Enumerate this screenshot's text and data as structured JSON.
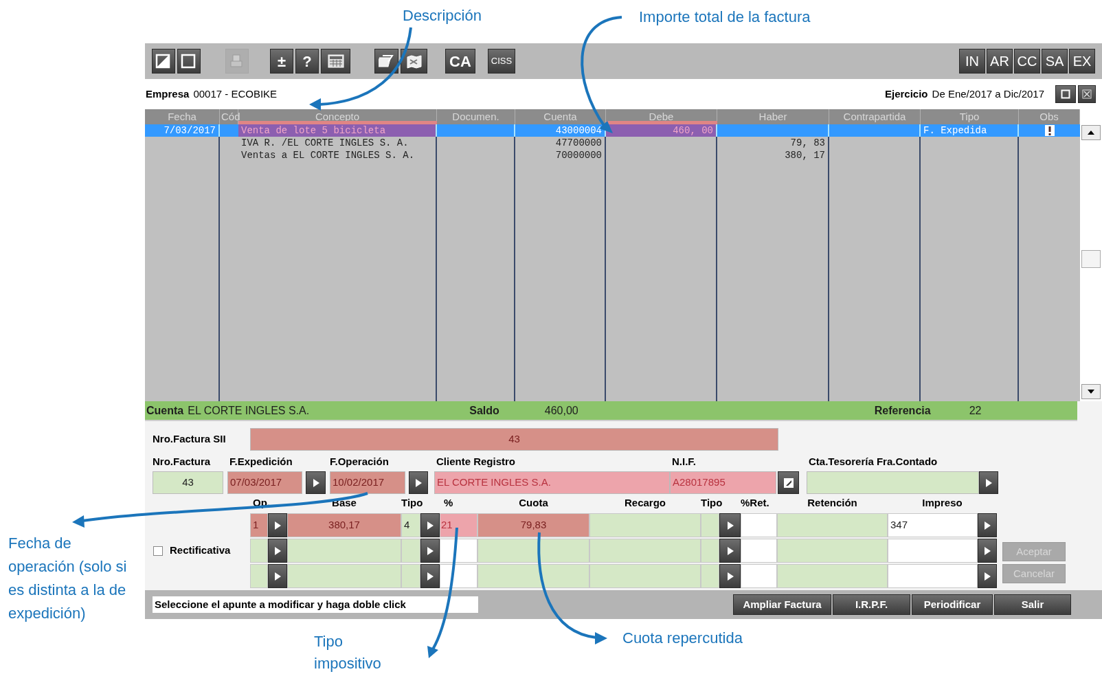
{
  "annotations": [
    {
      "text": "Descripción"
    },
    {
      "text": "Importe total de la factura"
    },
    {
      "text": "Fecha de operación (solo si es distinta a la de expedición)"
    },
    {
      "text": "Tipo impositivo"
    },
    {
      "text": "Cuota repercutida"
    }
  ],
  "toolbar": {
    "left": [
      {
        "kind": "icon",
        "disabled": false
      },
      {
        "kind": "icon",
        "disabled": false
      },
      {
        "kind": "icon",
        "disabled": true
      },
      {
        "kind": "text",
        "label": "±",
        "disabled": false
      },
      {
        "kind": "text",
        "label": "?",
        "disabled": false
      },
      {
        "kind": "icon",
        "disabled": false
      },
      {
        "kind": "icon",
        "disabled": false
      },
      {
        "kind": "icon",
        "disabled": false
      },
      {
        "kind": "text",
        "label": "CA",
        "disabled": false
      },
      {
        "kind": "text",
        "label": "CISS",
        "disabled": false
      }
    ],
    "right": [
      "IN",
      "AR",
      "CC",
      "SA",
      "EX"
    ]
  },
  "company": {
    "label": "Empresa",
    "value": "00017 - ECOBIKE"
  },
  "period": {
    "label": "Ejercicio",
    "value": "De Ene/2017 a Dic/2017"
  },
  "table": {
    "columns": [
      "Fecha",
      "Cód",
      "Concepto",
      "Documen.",
      "Cuenta",
      "Debe",
      "Haber",
      "Contrapartida",
      "Tipo",
      "Obs"
    ],
    "rows": [
      {
        "selected": true,
        "flag": true,
        "marked": true,
        "cells": [
          "7/03/2017",
          "",
          "Venta de lote 5 bicicleta",
          "",
          "43000004",
          "460, 00",
          "",
          "",
          "F. Expedida"
        ]
      },
      {
        "selected": false,
        "flag": false,
        "marked": false,
        "cells": [
          "",
          "",
          "IVA R. /EL CORTE INGLES S. A.",
          "",
          "47700000",
          "",
          "79, 83",
          "",
          ""
        ]
      },
      {
        "selected": false,
        "flag": false,
        "marked": false,
        "cells": [
          "",
          "",
          "Ventas a EL CORTE INGLES S. A.",
          "",
          "70000000",
          "",
          "380, 17",
          "",
          ""
        ]
      }
    ]
  },
  "account_bar": {
    "cuenta_label": "Cuenta",
    "cuenta": "EL CORTE INGLES S.A.",
    "saldo_label": "Saldo",
    "saldo": "460,00",
    "referencia_label": "Referencia",
    "referencia": "22"
  },
  "invoice_sii": {
    "label": "Nro.Factura SII",
    "value": "43",
    "color": "#d69088"
  },
  "header_fields": [
    {
      "label": "Nro.Factura",
      "value": "43",
      "color": "#d5e8c6"
    },
    {
      "label": "F.Expedición",
      "value": "07/03/2017",
      "color": "#d69088"
    },
    {
      "label": "F.Operación",
      "value": "10/02/2017",
      "color": "#d69088"
    },
    {
      "label": "Cliente Registro",
      "value": "EL CORTE INGLES S.A.",
      "color": "#eda4ab"
    },
    {
      "label": "N.I.F.",
      "value": "A28017895",
      "color": "#eda4ab"
    },
    {
      "label": "Cta.Tesorería Fra.Contado",
      "color": "#d5e8c6"
    }
  ],
  "lines": {
    "columns": [
      "Op.",
      "Base",
      "Tipo",
      "%",
      "Cuota",
      "Recargo",
      "Tipo",
      "%Ret.",
      "Retención",
      "Impreso"
    ],
    "rows": [
      {
        "op": {
          "value": "1",
          "color": "#d69088"
        },
        "base": {
          "value": "380,17",
          "color": "#d69088"
        },
        "tipo": {
          "value": "4",
          "color": "#d5e8c6"
        },
        "pct": {
          "value": "21",
          "color": "#eda4ab"
        },
        "cuota": {
          "value": "79,83",
          "color": "#d69088"
        },
        "impreso": {
          "value": "347",
          "color": "#ffffff"
        }
      }
    ]
  },
  "rectificativa": {
    "label": "Rectificativa",
    "checked": false
  },
  "side_buttons": [
    {
      "label": "Aceptar",
      "disabled": true
    },
    {
      "label": "Cancelar",
      "disabled": true
    }
  ],
  "message": "Seleccione el apunte a modificar y haga doble click",
  "bottom_buttons": [
    "Ampliar Factura",
    "I.R.P.F.",
    "Periodificar",
    "Salir"
  ]
}
